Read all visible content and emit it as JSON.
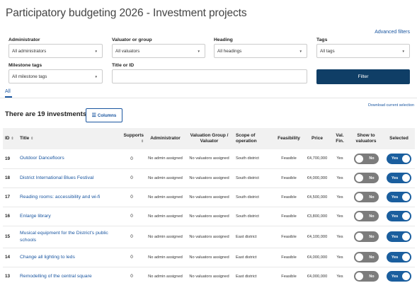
{
  "page": {
    "title": "Participatory budgeting 2026 - Investment projects",
    "advanced_filters": "Advanced filters"
  },
  "filters": {
    "administrator": {
      "label": "Administrator",
      "value": "All administrators"
    },
    "valuator": {
      "label": "Valuator or group",
      "value": "All valuators"
    },
    "heading": {
      "label": "Heading",
      "value": "All headings"
    },
    "tags": {
      "label": "Tags",
      "value": "All tags"
    },
    "milestone": {
      "label": "Milestone tags",
      "value": "All milestone tags"
    },
    "title_or_id": {
      "label": "Title or ID",
      "value": ""
    },
    "filter_button": "Filter"
  },
  "tabs": {
    "all": "All",
    "download": "Download current selection"
  },
  "summary": {
    "count_text": "There are 19 investments",
    "columns_button": "Columns"
  },
  "table": {
    "headers": {
      "id": "ID",
      "title": "Title",
      "supports": "Supports",
      "administrator": "Administrator",
      "valuation_1": "Valuation Group /",
      "valuation_2": "Valuator",
      "scope_1": "Scope of",
      "scope_2": "operation",
      "feasibility": "Feasibility",
      "price": "Price",
      "valfin_1": "Val.",
      "valfin_2": "Fin.",
      "show_1": "Show to",
      "show_2": "valuators",
      "selected": "Selected"
    },
    "rows": [
      {
        "id": "19",
        "title": "Outdoor Dancefloors",
        "supports": "0",
        "admin": "No admin assigned",
        "valuators": "No valuators assigned",
        "scope": "South district",
        "feasibility": "Feasible",
        "price": "€4,700,000",
        "valfin": "Yes",
        "show": "No",
        "selected": "Yes"
      },
      {
        "id": "18",
        "title": "District International Blues Festival",
        "supports": "0",
        "admin": "No admin assigned",
        "valuators": "No valuators assigned",
        "scope": "South district",
        "feasibility": "Feasible",
        "price": "€4,000,000",
        "valfin": "Yes",
        "show": "No",
        "selected": "Yes"
      },
      {
        "id": "17",
        "title": "Reading rooms: accessibility and wi-fi",
        "supports": "0",
        "admin": "No admin assigned",
        "valuators": "No valuators assigned",
        "scope": "South district",
        "feasibility": "Feasible",
        "price": "€4,500,000",
        "valfin": "Yes",
        "show": "No",
        "selected": "Yes"
      },
      {
        "id": "16",
        "title": "Enlarge library",
        "supports": "0",
        "admin": "No admin assigned",
        "valuators": "No valuators assigned",
        "scope": "South district",
        "feasibility": "Feasible",
        "price": "€3,800,000",
        "valfin": "Yes",
        "show": "No",
        "selected": "Yes"
      },
      {
        "id": "15",
        "title": "Musical equipment for the District's public schools",
        "supports": "0",
        "admin": "No admin assigned",
        "valuators": "No valuators assigned",
        "scope": "East district",
        "feasibility": "Feasible",
        "price": "€4,100,000",
        "valfin": "Yes",
        "show": "No",
        "selected": "Yes"
      },
      {
        "id": "14",
        "title": "Change all lighting to leds",
        "supports": "0",
        "admin": "No admin assigned",
        "valuators": "No valuators assigned",
        "scope": "East district",
        "feasibility": "Feasible",
        "price": "€4,000,000",
        "valfin": "Yes",
        "show": "No",
        "selected": "Yes"
      },
      {
        "id": "13",
        "title": "Remodelling of the central square",
        "supports": "0",
        "admin": "No admin assigned",
        "valuators": "No valuators assigned",
        "scope": "East district",
        "feasibility": "Feasible",
        "price": "€4,000,000",
        "valfin": "Yes",
        "show": "No",
        "selected": "Yes"
      }
    ]
  },
  "colors": {
    "link": "#1a56a0",
    "primary_button": "#0f3e66",
    "toggle_on": "#1a5e9e",
    "toggle_off": "#7c7c7c"
  }
}
